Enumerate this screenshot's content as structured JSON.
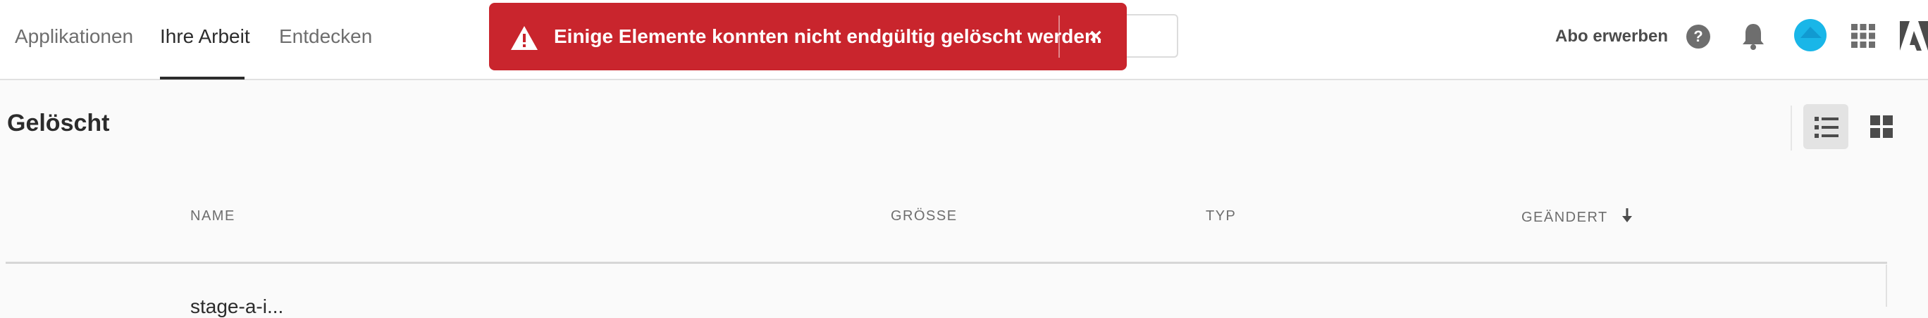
{
  "nav": {
    "tabs": [
      {
        "label": "Applikationen"
      },
      {
        "label": "Ihre Arbeit",
        "active": true
      },
      {
        "label": "Entdecken"
      }
    ]
  },
  "toast": {
    "message": "Einige Elemente konnten nicht endgültig gelöscht werden.",
    "close_label": "×",
    "icon": "warning-icon",
    "color": "#c9252d"
  },
  "header_right": {
    "subscribe_label": "Abo erwerben",
    "icons": [
      "help-icon",
      "bell-icon",
      "avatar",
      "app-grid-icon",
      "adobe-logo"
    ]
  },
  "main": {
    "title": "Gelöscht",
    "view_modes": [
      "list-view-icon",
      "grid-view-icon"
    ],
    "selected_view": "list"
  },
  "table": {
    "columns": [
      {
        "label": "NAME"
      },
      {
        "label": "GRÖSSE"
      },
      {
        "label": "TYP"
      },
      {
        "label": "GEÄNDERT",
        "sort": "descending"
      }
    ],
    "rows": [
      {
        "name": "stage-a-i..."
      }
    ]
  }
}
